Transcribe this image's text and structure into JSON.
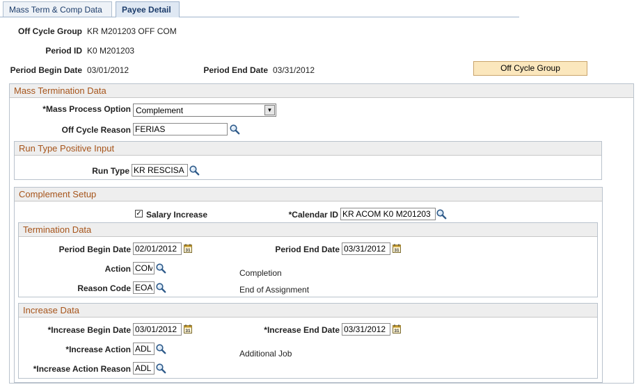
{
  "tabs": {
    "mass_term": "Mass Term & Comp Data",
    "payee_detail": "Payee Detail"
  },
  "header": {
    "off_cycle_group_label": "Off Cycle Group",
    "off_cycle_group_value": "KR M201203 OFF COM",
    "period_id_label": "Period ID",
    "period_id_value": "K0 M201203",
    "period_begin_label": "Period Begin Date",
    "period_begin_value": "03/01/2012",
    "period_end_label": "Period End Date",
    "period_end_value": "03/31/2012",
    "off_cycle_group_button": "Off Cycle Group"
  },
  "mass_termination": {
    "title": "Mass Termination Data",
    "mass_process_label": "*Mass Process Option",
    "mass_process_value": "Complement",
    "off_cycle_reason_label": "Off Cycle Reason",
    "off_cycle_reason_value": "FERIAS"
  },
  "run_type_input": {
    "title": "Run Type Positive Input",
    "run_type_label": "Run Type",
    "run_type_value": "KR RESCISA"
  },
  "complement_setup": {
    "title": "Complement Setup",
    "salary_increase_label": "Salary Increase",
    "salary_increase_checked": true,
    "calendar_id_label": "*Calendar ID",
    "calendar_id_value": "KR ACOM K0 M201203"
  },
  "termination_data": {
    "title": "Termination Data",
    "period_begin_label": "Period Begin Date",
    "period_begin_value": "02/01/2012",
    "period_end_label": "Period End Date",
    "period_end_value": "03/31/2012",
    "action_label": "Action",
    "action_value": "COM",
    "action_desc": "Completion",
    "reason_label": "Reason Code",
    "reason_value": "EOA",
    "reason_desc": "End of Assignment"
  },
  "increase_data": {
    "title": "Increase Data",
    "begin_label": "*Increase Begin Date",
    "begin_value": "03/01/2012",
    "end_label": "*Increase End Date",
    "end_value": "03/31/2012",
    "action_label": "*Increase Action",
    "action_value": "ADL",
    "action_desc": "Additional Job",
    "reason_label": "*Increase Action Reason",
    "reason_value": "ADL"
  },
  "icons": {
    "lookup": "magnifier-icon",
    "calendar": "calendar-icon",
    "dropdown": "chevron-down-icon",
    "check": "checkmark-icon"
  },
  "colors": {
    "section_title": "#a6541a",
    "tab_text": "#1d3d6b",
    "button_bg": "#fbe7bd"
  }
}
